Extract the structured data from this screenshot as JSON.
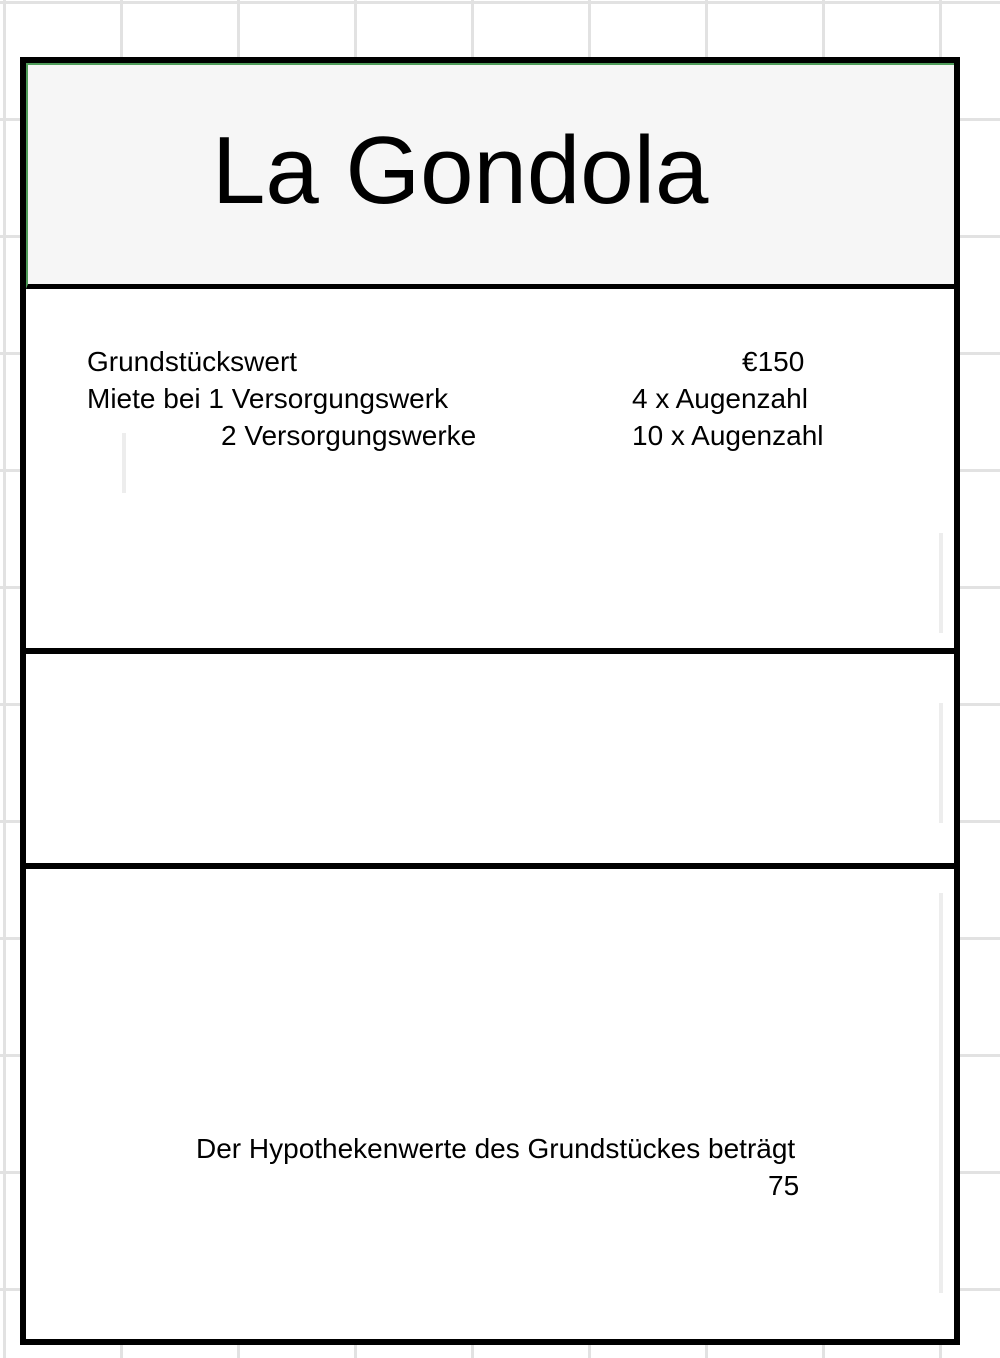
{
  "card": {
    "title": "La Gondola",
    "rows": [
      {
        "label": "Grundstückswert",
        "value": "€150"
      },
      {
        "label": "Miete bei 1 Versorgungswerk",
        "value": "4 x Augenzahl"
      },
      {
        "label": "2 Versorgungswerke",
        "value": "10 x Augenzahl"
      }
    ],
    "mortgage_text": "Der Hypothekenwerte des Grundstückes beträgt",
    "mortgage_value": "75"
  },
  "colors": {
    "border": "#000000",
    "title_background": "#f6f6f6",
    "accent_edge": "#4f9d5a",
    "grid": "#e2e2e2"
  }
}
